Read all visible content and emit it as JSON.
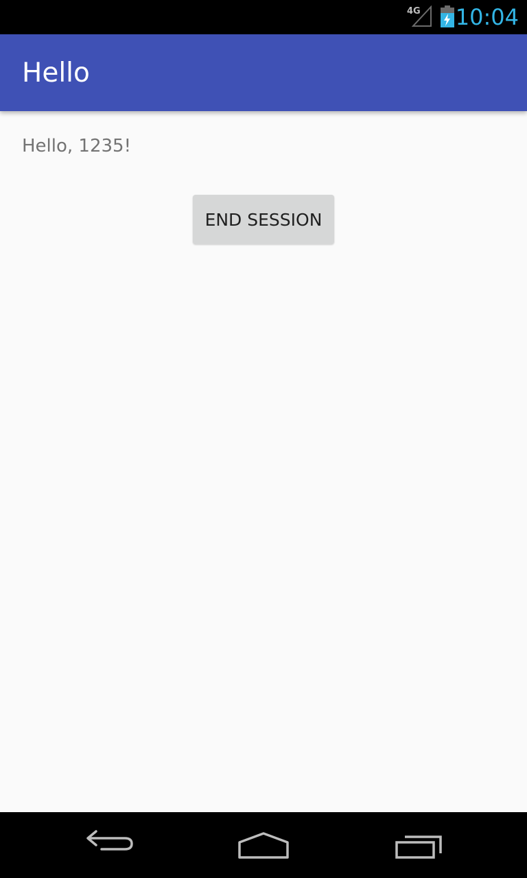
{
  "status_bar": {
    "network_type": "4G",
    "time": "10:04",
    "icons": [
      "signal-icon",
      "battery-charging-icon"
    ],
    "clock_color": "#33b5e5"
  },
  "app_bar": {
    "title": "Hello",
    "color": "#3f51b5"
  },
  "content": {
    "greeting": "Hello, 1235!",
    "end_session_label": "END SESSION"
  },
  "nav_bar": {
    "icons": [
      "back-icon",
      "home-icon",
      "recents-icon"
    ]
  }
}
